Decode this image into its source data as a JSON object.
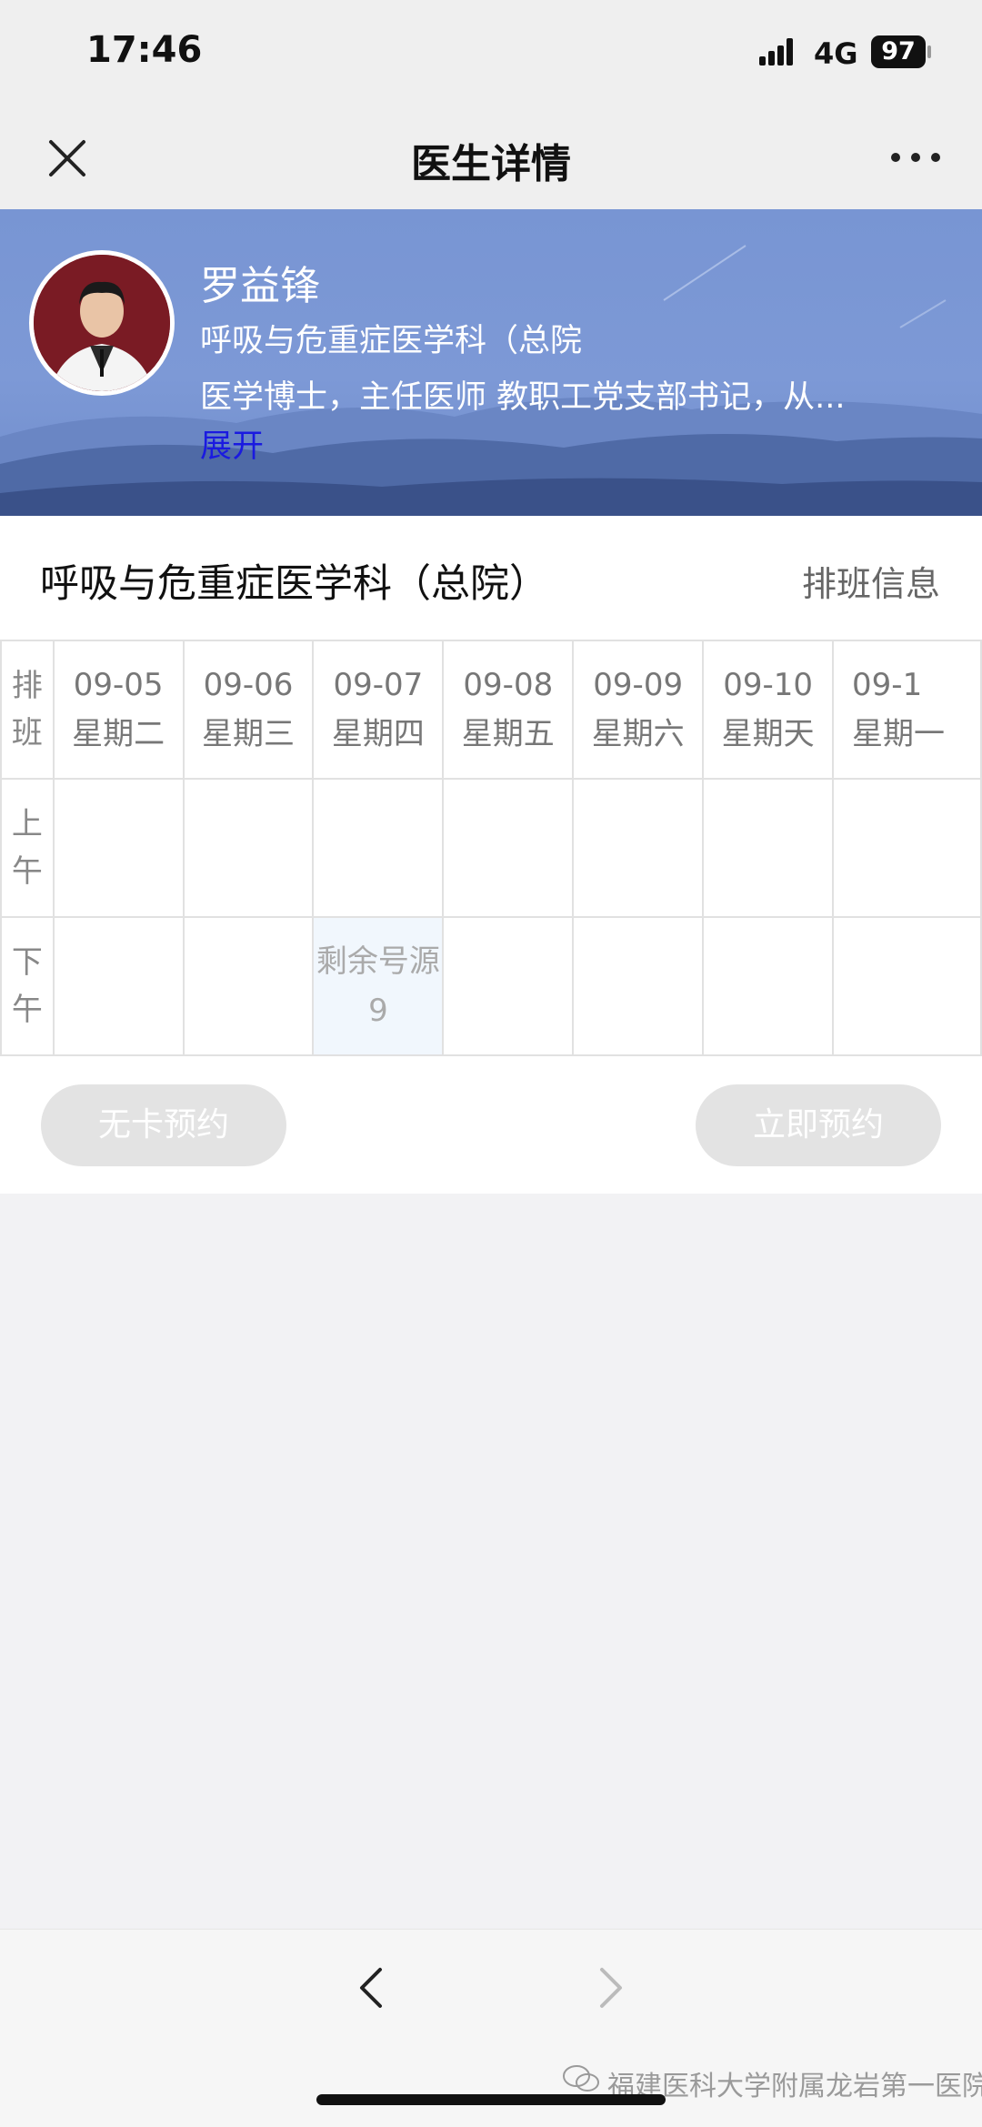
{
  "status": {
    "time": "17:46",
    "network": "4G",
    "battery": "97"
  },
  "nav": {
    "title": "医生详情"
  },
  "doctor": {
    "name": "罗益锋",
    "department": "呼吸与危重症医学科（总院",
    "description": "医学博士，主任医师 教职工党支部书记，从...",
    "expand_label": "展开"
  },
  "schedule": {
    "department_title": "呼吸与危重症医学科（总院）",
    "info_link": "排班信息",
    "header_label": [
      "排",
      "班"
    ],
    "morning_label": [
      "上",
      "午"
    ],
    "afternoon_label": [
      "下",
      "午"
    ],
    "days": [
      {
        "date": "09-05",
        "weekday": "星期二"
      },
      {
        "date": "09-06",
        "weekday": "星期三"
      },
      {
        "date": "09-07",
        "weekday": "星期四"
      },
      {
        "date": "09-08",
        "weekday": "星期五"
      },
      {
        "date": "09-09",
        "weekday": "星期六"
      },
      {
        "date": "09-10",
        "weekday": "星期天"
      },
      {
        "date": "09-1",
        "weekday": "星期一"
      }
    ],
    "slot": {
      "label": "剩余号源",
      "count": "9"
    }
  },
  "buttons": {
    "no_card": "无卡预约",
    "book_now": "立即预约"
  },
  "footer": {
    "watermark": "福建医科大学附属龙岩第一医院"
  }
}
